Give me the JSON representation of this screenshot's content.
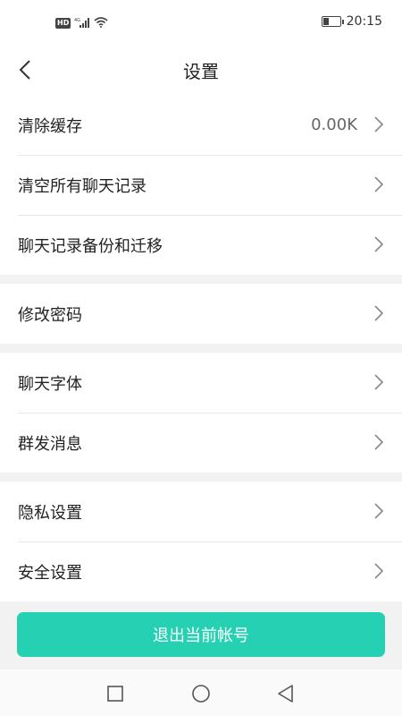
{
  "status_bar": {
    "hd": "HD",
    "network": "4G",
    "time": "20:15",
    "battery_level": 0.35
  },
  "header": {
    "title": "设置"
  },
  "groups": [
    [
      {
        "label": "清除缓存",
        "value": "0.00K"
      },
      {
        "label": "清空所有聊天记录"
      },
      {
        "label": "聊天记录备份和迁移"
      }
    ],
    [
      {
        "label": "修改密码"
      }
    ],
    [
      {
        "label": "聊天字体"
      },
      {
        "label": "群发消息"
      }
    ],
    [
      {
        "label": "隐私设置"
      },
      {
        "label": "安全设置"
      }
    ]
  ],
  "logout": {
    "label": "退出当前帐号"
  },
  "colors": {
    "accent": "#25d1b2",
    "background": "#f2f2f2"
  }
}
